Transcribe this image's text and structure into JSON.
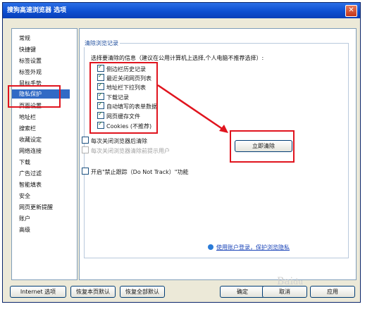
{
  "window": {
    "title": "搜狗高速浏览器 选项",
    "close_glyph": "✕"
  },
  "nav": {
    "items": [
      {
        "label": "常规"
      },
      {
        "label": "快捷键"
      },
      {
        "label": "标签设置"
      },
      {
        "label": "标签外观"
      },
      {
        "label": "鼠标手势"
      },
      {
        "label": "隐私保护"
      },
      {
        "label": "页面设置"
      },
      {
        "label": "地址栏"
      },
      {
        "label": "搜索栏"
      },
      {
        "label": "收藏设定"
      },
      {
        "label": "网络连接"
      },
      {
        "label": "下载"
      },
      {
        "label": "广告过滤"
      },
      {
        "label": "智能填表"
      },
      {
        "label": "安全"
      },
      {
        "label": "网页更新提醒"
      },
      {
        "label": "账户"
      },
      {
        "label": "高级"
      }
    ],
    "selected": "隐私保护"
  },
  "privacy": {
    "group_title": "清除浏览记录",
    "instruction": "选择要清除的信息（建议在公用计算机上选择,个人电脑不推荐选择）:",
    "items": [
      {
        "label": "侧边栏历史记录",
        "checked": true
      },
      {
        "label": "最近关闭网页列表",
        "checked": true
      },
      {
        "label": "地址栏下拉列表",
        "checked": true
      },
      {
        "label": "下载记录",
        "checked": true
      },
      {
        "label": "自动填写的表单数据",
        "checked": true
      },
      {
        "label": "网页缓存文件",
        "checked": true
      },
      {
        "label": "Cookies (不推荐)",
        "checked": true
      }
    ],
    "clear_on_close": {
      "label": "每次关闭浏览器后清除",
      "checked": false
    },
    "prompt_before_clear": {
      "label": "每次关闭浏览器清除前提示用户",
      "checked": false,
      "disabled": true
    },
    "clear_now_button": "立即清除",
    "dnt": {
      "label": "开启\"禁止跟踪（Do Not Track）\"功能",
      "checked": false
    },
    "account_link": "使用账户登录，保护浏览隐私"
  },
  "footer": {
    "ie_options": "Internet 选项",
    "restore_page": "恢复本页默认",
    "restore_all": "恢复全部默认",
    "ok": "确定",
    "cancel": "取消",
    "apply": "应用"
  },
  "colors": {
    "annotation_red": "#e0141e",
    "selection_blue": "#316ac5",
    "title_blue": "#0e4fd1"
  }
}
